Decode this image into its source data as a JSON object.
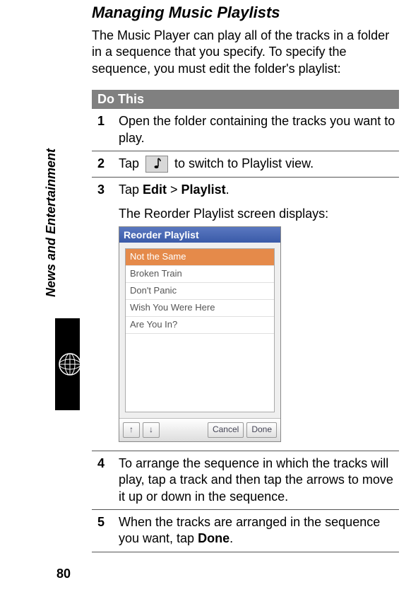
{
  "sidebar": {
    "section_label": "News and Entertainment"
  },
  "page_number": "80",
  "heading": "Managing Music Playlists",
  "intro": "The Music Player can play all of the tracks in a folder in a sequence that you specify. To specify the sequence, you must edit the folder's playlist:",
  "do_this": "Do This",
  "steps": {
    "s1": {
      "num": "1",
      "text": "Open the folder containing the tracks you want to play."
    },
    "s2": {
      "num": "2",
      "pre": "Tap ",
      "post": " to switch to Playlist view."
    },
    "s3": {
      "num": "3",
      "text_parts": {
        "a": "Tap ",
        "b": "Edit",
        "c": " > ",
        "d": "Playlist",
        "e": "."
      },
      "caption": "The Reorder Playlist screen displays:"
    },
    "s4": {
      "num": "4",
      "text": "To arrange the sequence in which the tracks will play, tap a track and then tap the arrows to move it up or down in the sequence."
    },
    "s5": {
      "num": "5",
      "text_parts": {
        "a": "When the tracks are arranged in the sequence you want, tap ",
        "b": "Done",
        "c": "."
      }
    }
  },
  "screenshot": {
    "title": "Reorder Playlist",
    "items": [
      "Not the Same",
      "Broken Train",
      "Don't Panic",
      "Wish You Were Here",
      "Are You In?"
    ],
    "buttons": {
      "up": "↑",
      "down": "↓",
      "cancel": "Cancel",
      "done": "Done"
    }
  }
}
